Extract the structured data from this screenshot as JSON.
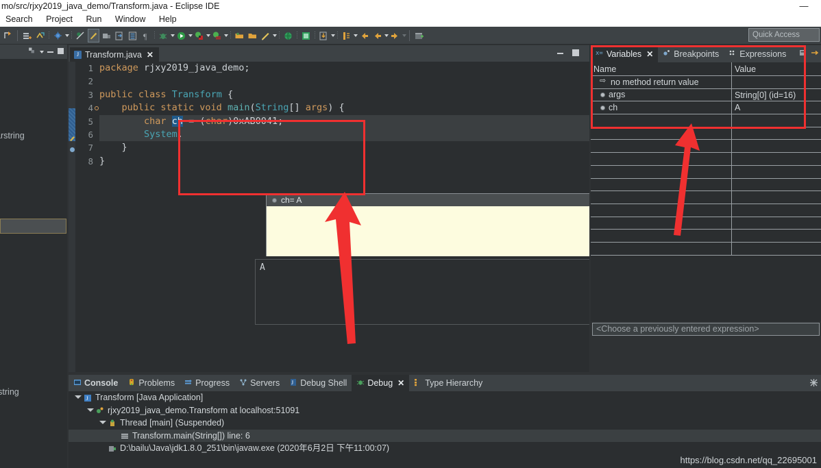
{
  "window": {
    "title": "mo/src/rjxy2019_java_demo/Transform.java - Eclipse IDE",
    "minimize_glyph": "—"
  },
  "menu": {
    "items": [
      {
        "label": "Search"
      },
      {
        "label": "Project"
      },
      {
        "label": "Run"
      },
      {
        "label": "Window"
      },
      {
        "label": "Help"
      }
    ]
  },
  "quick_access": {
    "placeholder": "Quick Access",
    "value": "Quick Access"
  },
  "left_panel": {
    "fragments": [
      {
        "text": "arstring"
      },
      {
        "text": "]"
      },
      {
        "text": "rstring"
      }
    ]
  },
  "editor": {
    "tab": {
      "label": "Transform.java",
      "file_icon": "java-file-icon",
      "close_glyph": "✕"
    },
    "minimize_title": "Minimize",
    "maximize_title": "Maximize",
    "lines": [
      {
        "n": "1",
        "tokens": [
          {
            "t": "package ",
            "c": "kw"
          },
          {
            "t": "rjxy2019_java_demo;",
            "c": "pln"
          }
        ]
      },
      {
        "n": "2",
        "tokens": []
      },
      {
        "n": "3",
        "tokens": [
          {
            "t": "public class ",
            "c": "kw"
          },
          {
            "t": "Transform",
            "c": "cls"
          },
          {
            "t": " {",
            "c": "pln"
          }
        ]
      },
      {
        "n": "4",
        "fold": true,
        "tokens": [
          {
            "t": "    public static void ",
            "c": "kw"
          },
          {
            "t": "main",
            "c": "typ"
          },
          {
            "t": "(",
            "c": "pln"
          },
          {
            "t": "String",
            "c": "cls"
          },
          {
            "t": "[] ",
            "c": "pln"
          },
          {
            "t": "args",
            "c": "kw"
          },
          {
            "t": ") {",
            "c": "pln"
          }
        ]
      },
      {
        "n": "5",
        "hl": true,
        "tokens": [
          {
            "t": "        char ",
            "c": "kw"
          },
          {
            "t": "ch",
            "c": "sel-ident"
          },
          {
            "t": " = (",
            "c": "pln"
          },
          {
            "t": "char",
            "c": "kw"
          },
          {
            "t": ")0xAB0041;",
            "c": "pln"
          }
        ]
      },
      {
        "n": "6",
        "hl": true,
        "tokens": [
          {
            "t": "        ",
            "c": "pln"
          },
          {
            "t": "System",
            "c": "cls"
          },
          {
            "t": ".",
            "c": "pln"
          }
        ]
      },
      {
        "n": "7",
        "tokens": [
          {
            "t": "    }",
            "c": "pln"
          }
        ]
      },
      {
        "n": "8",
        "tokens": [
          {
            "t": "}",
            "c": "pln"
          }
        ]
      }
    ]
  },
  "tooltip": {
    "label": "ch= A",
    "bullet_icon": "variable-bullet-icon"
  },
  "console_output": {
    "text": "A"
  },
  "debug_panel": {
    "tabs": [
      {
        "label": "Variables",
        "active": true,
        "closable": true,
        "icon": "variables-icon"
      },
      {
        "label": "Breakpoints",
        "active": false,
        "closable": false,
        "icon": "breakpoints-icon"
      },
      {
        "label": "Expressions",
        "active": false,
        "closable": false,
        "icon": "expressions-icon"
      }
    ],
    "columns": [
      "Name",
      "Value"
    ],
    "rows": [
      {
        "name": "no method return value",
        "value": "",
        "icon": "return-value-icon"
      },
      {
        "name": "args",
        "value": "String[0]  (id=16)",
        "icon": "variable-bullet-icon"
      },
      {
        "name": "ch",
        "value": "A",
        "icon": "variable-bullet-icon"
      }
    ],
    "empty_row_count": 11,
    "expression_input_placeholder": "<Choose a previously entered expression>"
  },
  "bottom_panel": {
    "tabs": [
      {
        "label": "Console",
        "active": false,
        "bold": true,
        "closable": false,
        "icon": "console-icon"
      },
      {
        "label": "Problems",
        "active": false,
        "bold": false,
        "closable": false,
        "icon": "problems-icon"
      },
      {
        "label": "Progress",
        "active": false,
        "bold": false,
        "closable": false,
        "icon": "progress-icon"
      },
      {
        "label": "Servers",
        "active": false,
        "bold": false,
        "closable": false,
        "icon": "servers-icon"
      },
      {
        "label": "Debug Shell",
        "active": false,
        "bold": false,
        "closable": false,
        "icon": "debug-shell-icon"
      },
      {
        "label": "Debug",
        "active": true,
        "bold": false,
        "closable": true,
        "icon": "debug-icon"
      },
      {
        "label": "Type Hierarchy",
        "active": false,
        "bold": false,
        "closable": false,
        "icon": "type-hierarchy-icon"
      }
    ],
    "tree": [
      {
        "indent": 0,
        "twisty": true,
        "icon": "launch-icon",
        "label": "Transform [Java Application]",
        "selected": false
      },
      {
        "indent": 1,
        "twisty": true,
        "icon": "debug-target-icon",
        "label": "rjxy2019_java_demo.Transform at localhost:51091",
        "selected": false
      },
      {
        "indent": 2,
        "twisty": true,
        "icon": "thread-icon",
        "label": "Thread [main] (Suspended)",
        "selected": false
      },
      {
        "indent": 3,
        "twisty": false,
        "icon": "stack-frame-icon",
        "label": "Transform.main(String[]) line: 6",
        "selected": true
      },
      {
        "indent": 2,
        "twisty": false,
        "icon": "process-icon",
        "label": "D:\\bailu\\Java\\jdk1.8.0_251\\bin\\javaw.exe (2020年6月2日 下午11:00:07)",
        "selected": false
      }
    ]
  },
  "watermark": {
    "text": "https://blog.csdn.net/qq_22695001"
  },
  "annotations": {
    "accent_color": "#f03030",
    "rect_tooltip": "highlight-tooltip-region",
    "rect_variables": "highlight-variables-region",
    "arrow_to_tooltip": "arrow-pointing-to-tooltip",
    "arrow_to_variables": "arrow-pointing-to-variables"
  },
  "colors": {
    "chrome": "#3d4245",
    "editor_bg": "#2b2e30",
    "keyword": "#d09a5c",
    "class": "#4aa6b5",
    "selection": "#1f5a8a",
    "tooltip_bg": "#fdfcdf"
  }
}
